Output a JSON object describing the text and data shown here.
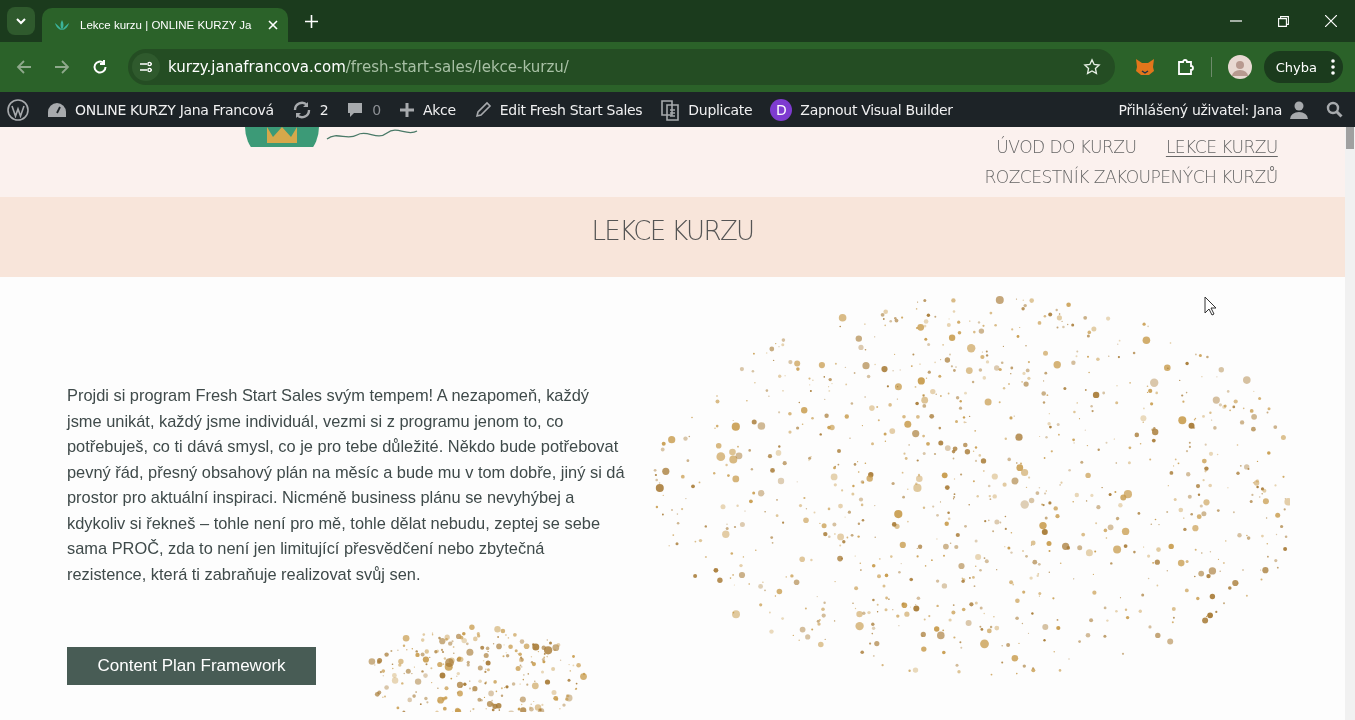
{
  "browser": {
    "tab": {
      "title": "Lekce kurzu | ONLINE KURZY Ja",
      "selected": true
    },
    "url": {
      "host": "kurzy.janafrancova.com",
      "path": "/fresh-start-sales/lekce-kurzu/"
    },
    "profile_button": "Chyba"
  },
  "admin_bar": {
    "site": "ONLINE KURZY Jana Francová",
    "updates": "2",
    "comments": "0",
    "new": "Akce",
    "edit": "Edit Fresh Start Sales",
    "duplicate": "Duplicate",
    "builder_badge": "D",
    "builder": "Zapnout Visual Builder",
    "user": "Přihlášený uživatel: Jana"
  },
  "nav": [
    {
      "label": "ÚVOD DO KURZU",
      "selected": false
    },
    {
      "label": "LEKCE KURZU",
      "selected": true
    },
    {
      "label": "ROZCESTNÍK ZAKOUPENÝCH KURZŮ",
      "selected": false
    }
  ],
  "hero": {
    "title": "LEKCE KURZU"
  },
  "content": {
    "paragraph": "Projdi si program Fresh Start Sales svým tempem! A nezapomeň, každý jsme unikát, každý jsme individuál, vezmi si z programu jenom to, co potřebuješ, co ti dává smysl, co je pro tebe důležité. Někdo bude potřebovat pevný řád, přesný obsahový plán na měsíc a bude mu v tom dobře, jiný si dá prostor pro aktuální inspiraci. Nicméně business plánu se nevyhýbej a kdykoliv si řekneš – tohle není pro mě, tohle dělat nebudu, zeptej se sebe sama PROČ, zda to není jen limitující přesvědčení nebo zbytečná rezistence, která ti zabraňuje realizovat svůj sen.",
    "button": "Content Plan Framework"
  }
}
